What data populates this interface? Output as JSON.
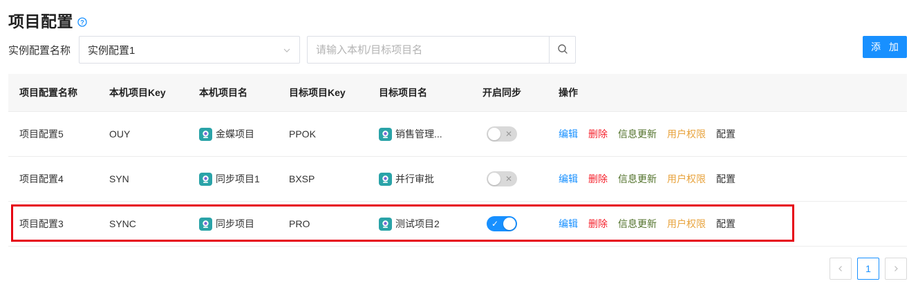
{
  "header": {
    "title": "项目配置",
    "help_icon": "question-circle-icon"
  },
  "filter": {
    "label": "实例配置名称",
    "select_value": "实例配置1",
    "search_placeholder": "请输入本机/目标项目名"
  },
  "toolbar": {
    "add_label": "添 加"
  },
  "table": {
    "columns": [
      "项目配置名称",
      "本机项目Key",
      "本机项目名",
      "目标项目Key",
      "目标项目名",
      "开启同步",
      "操作"
    ],
    "rows": [
      {
        "name": "项目配置5",
        "local_key": "OUY",
        "local_name": "金蝶项目",
        "target_key": "PPOK",
        "target_name": "销售管理...",
        "sync": false
      },
      {
        "name": "项目配置4",
        "local_key": "SYN",
        "local_name": "同步项目1",
        "target_key": "BXSP",
        "target_name": "并行审批",
        "sync": false
      },
      {
        "name": "项目配置3",
        "local_key": "SYNC",
        "local_name": "同步项目",
        "target_key": "PRO",
        "target_name": "测试项目2",
        "sync": true
      }
    ],
    "actions": {
      "edit": "编辑",
      "delete": "删除",
      "info": "信息更新",
      "perm": "用户权限",
      "config": "配置"
    }
  },
  "pagination": {
    "current_page": "1",
    "prev_icon": "chevron-left-icon",
    "next_icon": "chevron-right-icon"
  },
  "colors": {
    "primary": "#1890ff",
    "danger": "#f5222d",
    "success": "#52722b",
    "warning": "#e8a33d",
    "highlight": "#e60012",
    "project_icon": "#2aa3a8"
  }
}
